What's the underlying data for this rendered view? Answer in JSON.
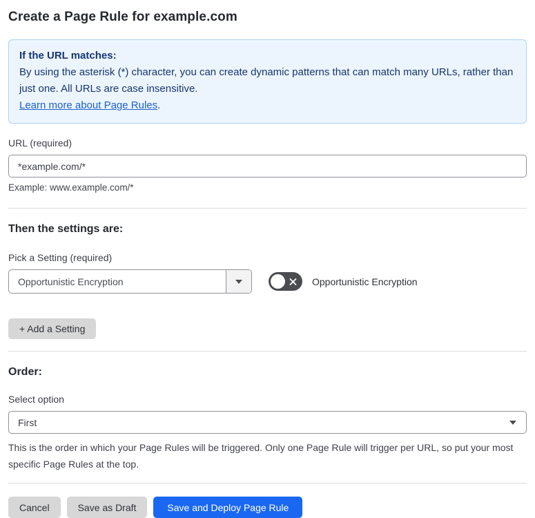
{
  "page": {
    "title": "Create a Page Rule for example.com"
  },
  "info_box": {
    "heading": "If the URL matches:",
    "body": "By using the asterisk (*) character, you can create dynamic patterns that can match many URLs, rather than just one. All URLs are case insensitive.",
    "link_label": "Learn more about Page Rules",
    "link_suffix": "."
  },
  "url_field": {
    "label": "URL (required)",
    "value": "*example.com/*",
    "helper": "Example: www.example.com/*"
  },
  "settings_section": {
    "heading": "Then the settings are:",
    "setting_label": "Pick a Setting (required)",
    "setting_value": "Opportunistic Encryption",
    "toggle_label": "Opportunistic Encryption",
    "toggle_state": "off",
    "add_setting_label": "+ Add a Setting"
  },
  "order_section": {
    "heading": "Order:",
    "select_label": "Select option",
    "select_value": "First",
    "helper": "This is the order in which your Page Rules will be triggered. Only one Page Rule will trigger per URL, so put your most specific Page Rules at the top."
  },
  "footer": {
    "cancel_label": "Cancel",
    "save_draft_label": "Save as Draft",
    "save_deploy_label": "Save and Deploy Page Rule"
  },
  "colors": {
    "primary_blue": "#1a68f2",
    "info_background": "#ecf5fe",
    "info_border": "#abd2f6",
    "info_text": "#16356e",
    "link_blue": "#1b5fd1",
    "toggle_off_gray": "#4a4c50",
    "button_gray": "#d7d7d7"
  }
}
